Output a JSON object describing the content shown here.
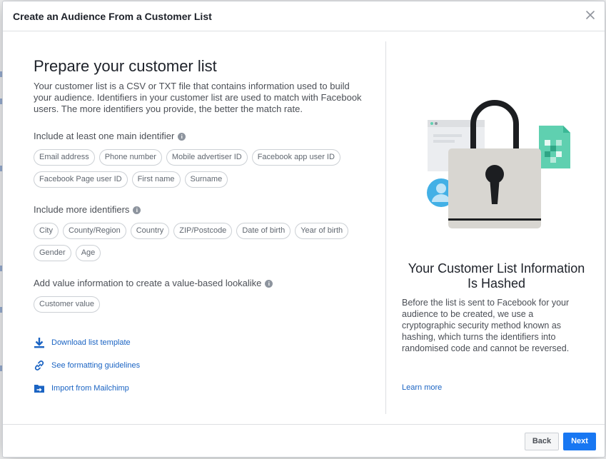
{
  "dialog": {
    "title": "Create an Audience From a Customer List"
  },
  "left": {
    "heading": "Prepare your customer list",
    "intro": "Your customer list is a CSV or TXT file that contains information used to build your audience. Identifiers in your customer list are used to match with Facebook users. The more identifiers you provide, the better the match rate.",
    "main_label": "Include at least one main identifier",
    "main_identifiers": [
      "Email address",
      "Phone number",
      "Mobile advertiser ID",
      "Facebook app user ID",
      "Facebook Page user ID",
      "First name",
      "Surname"
    ],
    "more_label": "Include more identifiers",
    "more_identifiers": [
      "City",
      "County/Region",
      "Country",
      "ZIP/Postcode",
      "Date of birth",
      "Year of birth",
      "Gender",
      "Age"
    ],
    "value_label": "Add value information to create a value-based lookalike",
    "value_identifiers": [
      "Customer value"
    ],
    "links": {
      "download": "Download list template",
      "formatting": "See formatting guidelines",
      "mailchimp": "Import from Mailchimp"
    }
  },
  "right": {
    "title": "Your Customer List Information Is Hashed",
    "body": "Before the list is sent to Facebook for your audience to be created, we use a cryptographic security method known as hashing, which turns the identifiers into randomised code and cannot be reversed.",
    "learn_more": "Learn more"
  },
  "footer": {
    "back": "Back",
    "next": "Next"
  },
  "colors": {
    "accent": "#1877f2",
    "link": "#1b64c3",
    "padlock_body": "#d8d6d1",
    "teal": "#5fd0b0",
    "avatar_blue": "#42b0e6"
  }
}
